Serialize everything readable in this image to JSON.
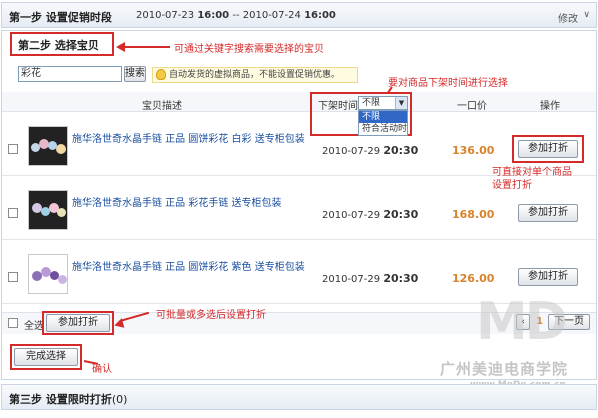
{
  "step1": {
    "title": "第一步 设置促销时段",
    "start_date": "2010-07-23",
    "start_time": "16:00",
    "separator": "--",
    "end_date": "2010-07-24",
    "end_time": "16:00",
    "edit_label": "修改"
  },
  "step2": {
    "title": "第二步 选择宝贝",
    "search_value": "彩花",
    "search_button": "搜索",
    "tip": "自动发货的虚拟商品，不能设置促销优惠。",
    "annot_search": "可通过关键字搜索需要选择的宝贝",
    "annot_time": "要对商品下架时间进行选择",
    "annot_single": "可直接对单个商品设置打折",
    "annot_batch": "可批量或多选后设置打折",
    "annot_confirm": "确认"
  },
  "table": {
    "col_desc": "宝贝描述",
    "col_time": "下架时间",
    "col_price": "一口价",
    "col_action": "操作",
    "time_filter_selected": "不限",
    "time_filter_options": [
      "不限",
      "符合活动时"
    ]
  },
  "items": [
    {
      "title": "施华洛世奇水晶手链 正品 圆饼彩花 白彩 送专柜包装",
      "date": "2010-07-29",
      "time": "20:30",
      "price": "136.00",
      "action": "参加打折"
    },
    {
      "title": "施华洛世奇水晶手链 正品 彩花手链 送专柜包装",
      "date": "2010-07-29",
      "time": "20:30",
      "price": "168.00",
      "action": "参加打折"
    },
    {
      "title": "施华洛世奇水晶手链 正品 圆饼彩花 紫色 送专柜包装",
      "date": "2010-07-29",
      "time": "20:30",
      "price": "126.00",
      "action": "参加打折"
    }
  ],
  "footer": {
    "select_all": "全选",
    "batch_button": "参加打折",
    "page_current": "1",
    "next_page": "下一页",
    "finish_button": "完成选择"
  },
  "step3": {
    "title": "第三步 设置限时打折",
    "count": "(0)"
  },
  "watermark": {
    "name": "广州美迪电商学院",
    "url": "www.MeDe.com.cn",
    "logo": "MD"
  },
  "colors": {
    "annotation_red": "#d42a2a",
    "price_orange": "#d9822b",
    "link_blue": "#1a4fa0"
  }
}
